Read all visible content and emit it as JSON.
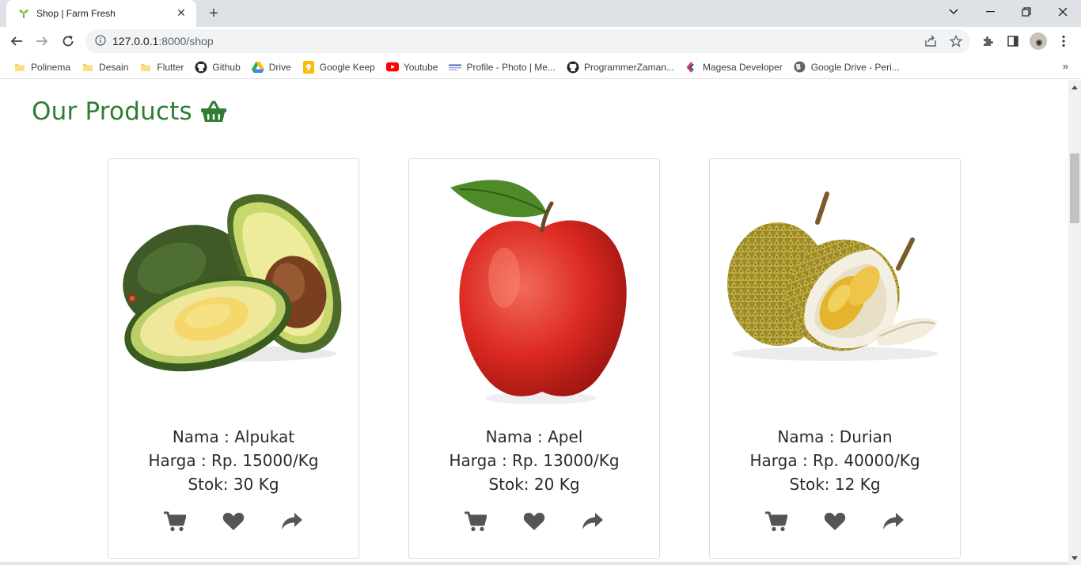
{
  "browser": {
    "tab_title": "Shop | Farm Fresh",
    "url_host": "127.0.0.1",
    "url_rest": ":8000/shop",
    "bookmarks": [
      {
        "label": "Polinema",
        "icon": "folder-icon"
      },
      {
        "label": "Desain",
        "icon": "folder-icon"
      },
      {
        "label": "Flutter",
        "icon": "folder-icon"
      },
      {
        "label": "Github",
        "icon": "github-icon"
      },
      {
        "label": "Drive",
        "icon": "google-drive-icon"
      },
      {
        "label": "Google Keep",
        "icon": "google-keep-icon"
      },
      {
        "label": "Youtube",
        "icon": "youtube-icon"
      },
      {
        "label": "Profile - Photo | Me...",
        "icon": "profile-icon"
      },
      {
        "label": "ProgrammerZaman...",
        "icon": "github-icon"
      },
      {
        "label": "Magesa Developer",
        "icon": "magesa-icon"
      },
      {
        "label": "Google Drive - Peri...",
        "icon": "globe-icon"
      }
    ],
    "more_bookmarks": "»"
  },
  "page": {
    "title": "Our Products",
    "title_icon": "basket-icon",
    "accent_color": "#2e7d32"
  },
  "products": [
    {
      "nama": "Nama : Alpukat",
      "harga": "Harga : Rp. 15000/Kg",
      "stok": "Stok: 30 Kg",
      "image": "avocado-image"
    },
    {
      "nama": "Nama : Apel",
      "harga": "Harga : Rp. 13000/Kg",
      "stok": "Stok: 20 Kg",
      "image": "apple-image"
    },
    {
      "nama": "Nama : Durian",
      "harga": "Harga : Rp. 40000/Kg",
      "stok": "Stok: 12 Kg",
      "image": "durian-image"
    }
  ],
  "actions": [
    "cart-icon",
    "heart-icon",
    "share-icon"
  ]
}
